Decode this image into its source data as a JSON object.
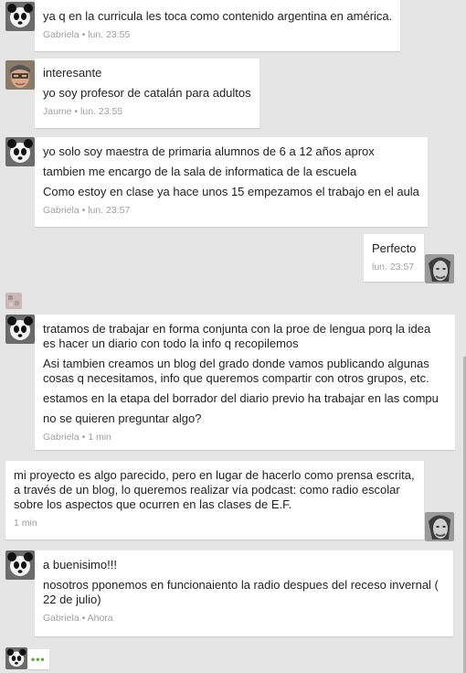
{
  "messages": [
    {
      "author": "Gabriela",
      "avatar": "panda-avatar",
      "lines": [
        "ya q en la curricula les toca como contenido argentina en américa."
      ],
      "time": "lun. 23:55",
      "meta": "Gabriela • lun. 23:55"
    },
    {
      "author": "Jaume",
      "avatar": "man-glasses-avatar",
      "lines": [
        "interesante",
        "yo soy profesor de catalán para adultos"
      ],
      "time": "lun. 23:55",
      "meta": "Jaume • lun. 23:55"
    },
    {
      "author": "Gabriela",
      "avatar": "panda-avatar",
      "lines": [
        "yo solo soy maestra de primaria alumnos de 6 a 12 años aprox",
        "tambien me encargo de la sala de informatica de la escuela",
        "Como estoy en clase ya hace unos 15 empezamos el trabajo en el aula"
      ],
      "time": "lun. 23:57",
      "meta": "Gabriela • lun. 23:57"
    },
    {
      "author": "self",
      "avatar": "man-portrait-avatar",
      "lines": [
        "Perfecto"
      ],
      "time": "lun. 23:57",
      "meta": "lun. 23:57"
    },
    {
      "author": "Gabriela",
      "avatar": "panda-avatar",
      "lines": [
        "tratamos de trabajar en forma conjunta con la proe de lengua porq la idea\nes hacer un diario con todo la info q recopilemos",
        "Asi tambien creamos un blog del grado donde vamos publicando algunas\ncosas q necesitamos, info que queremos compartir con otros grupos, etc.",
        "estamos en la etapa del borrador del diario previo ha trabajar en las compu",
        "no se quieren preguntar algo?"
      ],
      "time": "1 min",
      "meta": "Gabriela • 1 min"
    },
    {
      "author": "self",
      "avatar": "man-portrait-avatar",
      "lines": [
        "mi proyecto es algo parecido, pero en lugar de hacerlo como prensa escrita,\na través de un blog, lo queremos realizar vía podcast: como radio escolar\nsobre los aspectos que ocurren en las clases de E.F."
      ],
      "time": "1 min",
      "meta": "1 min"
    },
    {
      "author": "Gabriela",
      "avatar": "panda-avatar",
      "lines": [
        "a buenisimo!!!",
        "nosotros pponemos en funcionaiento la radio despues del receso invernal (\n22 de julio)"
      ],
      "time": "Ahora",
      "meta": "Gabriela • Ahora"
    }
  ],
  "typing_indicator": "•••",
  "colors": {
    "background": "#e5e5e5",
    "bubble": "#ffffff",
    "text": "#222222",
    "meta": "#a0a0a0",
    "typing": "#55aa33"
  }
}
